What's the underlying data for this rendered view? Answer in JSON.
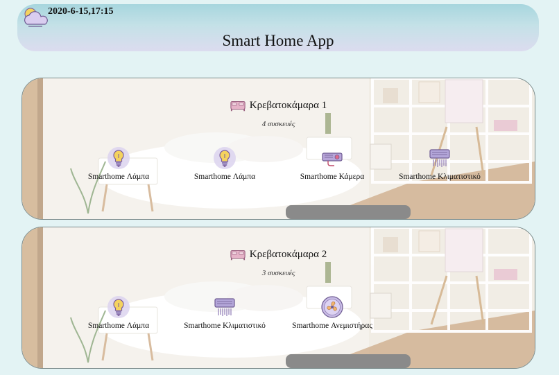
{
  "header": {
    "datetime": "2020-6-15,17:15",
    "title": "Smart Home App",
    "weather_icon": "weather-partly-cloudy-icon"
  },
  "rooms": [
    {
      "name": "Κρεβατοκάμαρα 1",
      "count": "4 συσκευές",
      "icon": "bed-icon",
      "devices": [
        {
          "label": "Smarthome Λάμπα",
          "icon": "lightbulb-icon"
        },
        {
          "label": "Smarthome Λάμπα",
          "icon": "lightbulb-icon"
        },
        {
          "label": "Smarthome Κάμερα",
          "icon": "camera-icon"
        },
        {
          "label": "Smarthome Κλιματιστικό",
          "icon": "air-conditioner-icon"
        }
      ]
    },
    {
      "name": "Κρεβατοκάμαρα 2",
      "count": "3 συσκευές",
      "icon": "bed-icon",
      "devices": [
        {
          "label": "Smarthome Λάμπα",
          "icon": "lightbulb-icon"
        },
        {
          "label": "Smarthome Κλιματιστικό",
          "icon": "air-conditioner-icon"
        },
        {
          "label": "Smarthome Ανεμιστήρας",
          "icon": "fan-icon"
        }
      ]
    }
  ],
  "colors": {
    "accent_purple": "#8f7bb5",
    "bulb_yellow": "#f4d35e",
    "header_top": "#a7d6de",
    "header_bottom": "#dcdcef"
  }
}
